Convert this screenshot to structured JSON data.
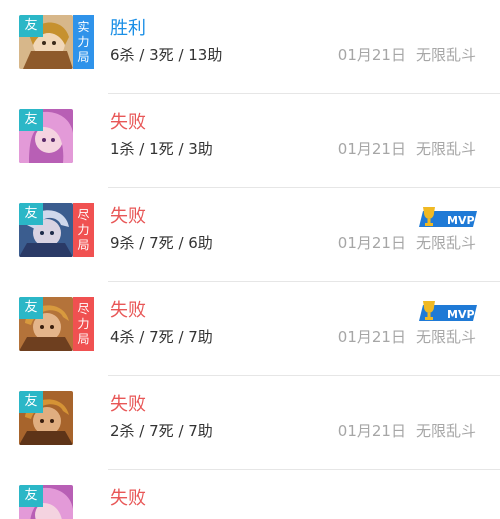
{
  "friend_label": "友",
  "mvp_label": "MVP",
  "matches": [
    {
      "result": "胜利",
      "result_type": "win",
      "kda": "6杀 / 3死 / 13助",
      "date": "01月21日",
      "mode": "无限乱斗",
      "mode_badge": [
        "实",
        "力",
        "局"
      ],
      "badge_color": "#2f93ea",
      "mvp": false,
      "hero_icon": "hero-golden-icon"
    },
    {
      "result": "失败",
      "result_type": "loss",
      "kda": "1杀 / 1死 / 3助",
      "date": "01月21日",
      "mode": "无限乱斗",
      "mode_badge": [],
      "badge_color": "",
      "mvp": false,
      "hero_icon": "hero-pink-icon"
    },
    {
      "result": "失败",
      "result_type": "loss",
      "kda": "9杀 / 7死 / 6助",
      "date": "01月21日",
      "mode": "无限乱斗",
      "mode_badge": [
        "尽",
        "力",
        "局"
      ],
      "badge_color": "#f05151",
      "mvp": true,
      "hero_icon": "hero-blue-icon"
    },
    {
      "result": "失败",
      "result_type": "loss",
      "kda": "4杀 / 7死 / 7助",
      "date": "01月21日",
      "mode": "无限乱斗",
      "mode_badge": [
        "尽",
        "力",
        "局"
      ],
      "badge_color": "#f05151",
      "mvp": true,
      "hero_icon": "hero-warrior-icon"
    },
    {
      "result": "失败",
      "result_type": "loss",
      "kda": "2杀 / 7死 / 7助",
      "date": "01月21日",
      "mode": "无限乱斗",
      "mode_badge": [],
      "badge_color": "",
      "mvp": false,
      "hero_icon": "hero-warrior-icon"
    },
    {
      "result": "失败",
      "result_type": "loss",
      "kda": "",
      "date": "",
      "mode": "",
      "mode_badge": [],
      "badge_color": "",
      "mvp": false,
      "hero_icon": "hero-pink-icon"
    }
  ],
  "colors": {
    "win": "#1a8fe6",
    "loss": "#e85757",
    "friend_badge": "#2bb7c7",
    "muted_text": "#a6a6a6"
  }
}
